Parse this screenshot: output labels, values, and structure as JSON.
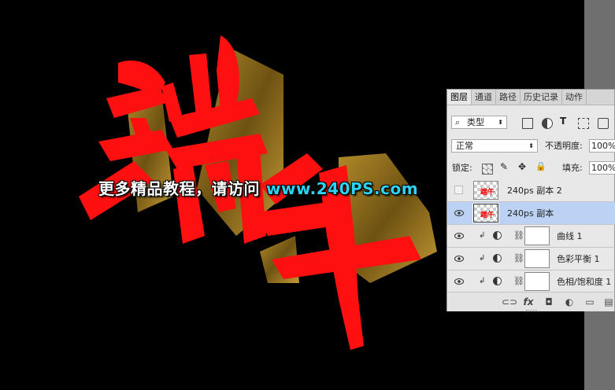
{
  "watermark": {
    "text_cn": "更多精品教程，请访问",
    "url": "www.240PS.com"
  },
  "artwork": {
    "chars": "端午",
    "fill_color": "#ff1010",
    "extrude_color": "#8a6a18"
  },
  "panel": {
    "tabs": [
      "图层",
      "通道",
      "路径",
      "历史记录",
      "动作"
    ],
    "filter": {
      "icon": "search-icon",
      "value": "类型"
    },
    "filter_icons": [
      "image-icon",
      "adjustment-icon",
      "type-icon",
      "shape-icon",
      "smart-object-icon"
    ],
    "blend_mode": "正常",
    "opacity_label": "不透明度:",
    "opacity_value": "100%",
    "lock_label": "锁定:",
    "fill_label": "填充:",
    "fill_value": "100%",
    "layers": [
      {
        "name": "240ps 副本 2",
        "visible": false,
        "selected": false,
        "thumb_text": "端午"
      },
      {
        "name": "240ps 副本",
        "visible": true,
        "selected": true,
        "thumb_text": "端午"
      }
    ],
    "adjustments": [
      {
        "name": "曲线 1"
      },
      {
        "name": "色彩平衡 1"
      },
      {
        "name": "色相/饱和度 1"
      }
    ],
    "footer_icons": [
      "link-icon",
      "fx-icon",
      "mask-icon",
      "adjustment-layer-icon",
      "folder-icon",
      "new-layer-icon"
    ]
  }
}
